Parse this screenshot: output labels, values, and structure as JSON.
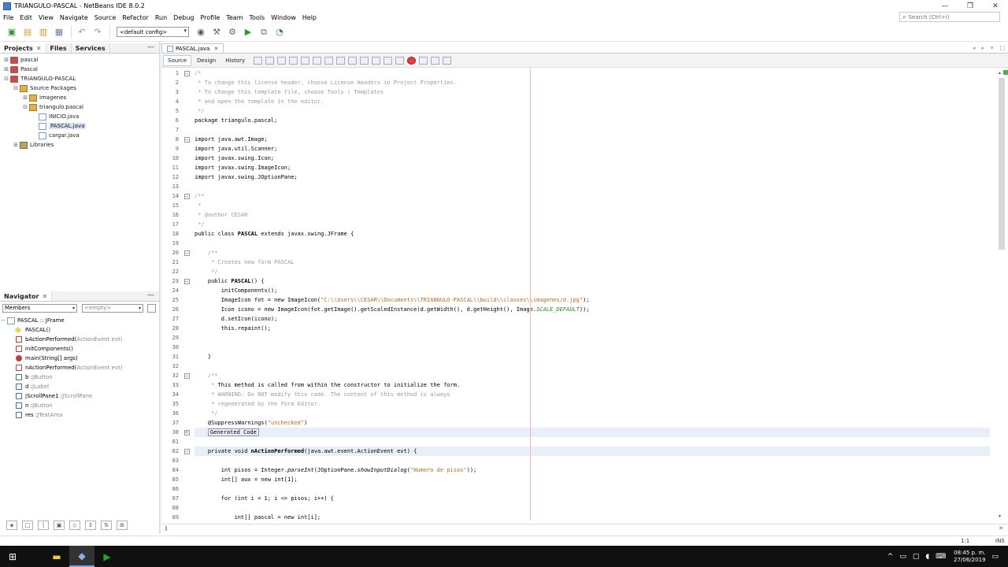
{
  "window": {
    "title": "TRIANGULO-PASCAL - NetBeans IDE 8.0.2",
    "controls": {
      "minimize": "—",
      "restore": "❐",
      "close": "✕"
    }
  },
  "menu": [
    "File",
    "Edit",
    "View",
    "Navigate",
    "Source",
    "Refactor",
    "Run",
    "Debug",
    "Profile",
    "Team",
    "Tools",
    "Window",
    "Help"
  ],
  "search": {
    "placeholder": "Search (Ctrl+I)"
  },
  "toolbar": {
    "config": "<default config>"
  },
  "projects_panel": {
    "tabs": [
      "Projects",
      "Files",
      "Services"
    ],
    "tree": [
      {
        "label": "pascal",
        "depth": 0,
        "icon": "proj",
        "twisty": "+"
      },
      {
        "label": "Pascal",
        "depth": 0,
        "icon": "proj",
        "twisty": "+"
      },
      {
        "label": "TRIANGULO-PASCAL",
        "depth": 0,
        "icon": "proj",
        "twisty": "−"
      },
      {
        "label": "Source Packages",
        "depth": 1,
        "icon": "pkg",
        "twisty": "−"
      },
      {
        "label": "imagenes",
        "depth": 2,
        "icon": "pkg",
        "twisty": "+"
      },
      {
        "label": "triangulo.pascal",
        "depth": 2,
        "icon": "pkg",
        "twisty": "−"
      },
      {
        "label": "INICIO.java",
        "depth": 3,
        "icon": "java",
        "twisty": ""
      },
      {
        "label": "PASCAL.java",
        "depth": 3,
        "icon": "java",
        "twisty": "",
        "selected": true
      },
      {
        "label": "cargar.java",
        "depth": 3,
        "icon": "java",
        "twisty": ""
      },
      {
        "label": "Libraries",
        "depth": 1,
        "icon": "lib",
        "twisty": "+"
      }
    ]
  },
  "navigator": {
    "title": "Navigator",
    "filter": "Members",
    "empty": "<empty>",
    "root": "PASCAL :: JFrame",
    "members": [
      {
        "name": "PASCAL()",
        "type": "",
        "icon": "ctor"
      },
      {
        "name": "bActionPerformed(",
        "type": "ActionEvent evt)",
        "icon": "priv"
      },
      {
        "name": "initComponents()",
        "type": "",
        "icon": "priv"
      },
      {
        "name": "main(String[] args)",
        "type": "",
        "icon": "pub"
      },
      {
        "name": "nActionPerformed(",
        "type": "ActionEvent evt)",
        "icon": "priv"
      },
      {
        "name": "b : ",
        "type": "JButton",
        "icon": "field"
      },
      {
        "name": "d : ",
        "type": "JLabel",
        "icon": "field"
      },
      {
        "name": "jScrollPane1 : ",
        "type": "JScrollPane",
        "icon": "field"
      },
      {
        "name": "n : ",
        "type": "JButton",
        "icon": "field"
      },
      {
        "name": "res : ",
        "type": "JTextArea",
        "icon": "field"
      }
    ]
  },
  "editor": {
    "tab": "PASCAL.java",
    "views": [
      "Source",
      "Design",
      "History"
    ],
    "lines": [
      {
        "n": "1",
        "fold": "−",
        "html": "<span class='cm'>/*</span>"
      },
      {
        "n": "2",
        "fold": "",
        "html": "<span class='cm'> * To change this license header, choose License Headers in Project Properties.</span>"
      },
      {
        "n": "3",
        "fold": "",
        "html": "<span class='cm'> * To change this template file, choose Tools | Templates</span>"
      },
      {
        "n": "4",
        "fold": "",
        "html": "<span class='cm'> * and open the template in the editor.</span>"
      },
      {
        "n": "5",
        "fold": "",
        "html": "<span class='cm'> */</span>"
      },
      {
        "n": "6",
        "fold": "",
        "html": "package triangulo.pascal;"
      },
      {
        "n": "7",
        "fold": "",
        "html": ""
      },
      {
        "n": "8",
        "fold": "−",
        "html": "import java.awt.Image;"
      },
      {
        "n": "9",
        "fold": "",
        "html": "import java.util.Scanner;"
      },
      {
        "n": "10",
        "fold": "",
        "html": "import javax.swing.Icon;"
      },
      {
        "n": "11",
        "fold": "",
        "html": "import javax.swing.ImageIcon;"
      },
      {
        "n": "12",
        "fold": "",
        "html": "import javax.swing.JOptionPane;"
      },
      {
        "n": "13",
        "fold": "",
        "html": ""
      },
      {
        "n": "14",
        "fold": "−",
        "html": "<span class='cm'>/**</span>"
      },
      {
        "n": "15",
        "fold": "",
        "html": "<span class='cm'> *</span>"
      },
      {
        "n": "16",
        "fold": "",
        "html": "<span class='cm'> * @author CESAR</span>"
      },
      {
        "n": "17",
        "fold": "",
        "html": "<span class='cm'> */</span>"
      },
      {
        "n": "18",
        "fold": "",
        "html": "public class <span class='bold'>PASCAL</span> extends javax.swing.JFrame {"
      },
      {
        "n": "19",
        "fold": "",
        "html": ""
      },
      {
        "n": "20",
        "fold": "−",
        "html": "    <span class='cm'>/**</span>"
      },
      {
        "n": "21",
        "fold": "",
        "html": "    <span class='cm'> * Creates new form PASCAL</span>"
      },
      {
        "n": "22",
        "fold": "",
        "html": "    <span class='cm'> */</span>"
      },
      {
        "n": "23",
        "fold": "−",
        "html": "    public <span class='bold'>PASCAL</span>() {"
      },
      {
        "n": "24",
        "fold": "",
        "html": "        initComponents();"
      },
      {
        "n": "25",
        "fold": "",
        "html": "        ImageIcon fot = new ImageIcon(<span class='str'>\"C:\\\\Users\\\\CESAR\\\\Documents\\\\TRIANGULO-PASCAL\\\\build\\\\classes\\\\imagenes/d.jpg\"</span>);"
      },
      {
        "n": "26",
        "fold": "",
        "html": "        Icon icono = new ImageIcon(fot.getImage().getScaledInstance(d.getWidth(), d.getHeight(), Image.<span class='grn'>SCALE_DEFAULT</span>));"
      },
      {
        "n": "27",
        "fold": "",
        "html": "        d.setIcon(icono);"
      },
      {
        "n": "28",
        "fold": "",
        "html": "        this.repaint();"
      },
      {
        "n": "29",
        "fold": "",
        "html": ""
      },
      {
        "n": "30",
        "fold": "",
        "html": ""
      },
      {
        "n": "31",
        "fold": "",
        "html": "    }"
      },
      {
        "n": "32",
        "fold": "",
        "html": ""
      },
      {
        "n": "32",
        "fold": "−",
        "html": "    <span class='cm'>/**</span>"
      },
      {
        "n": "33",
        "fold": "",
        "html": "    <span class='cm'> * </span>This method is called from within the constructor to initialize the form."
      },
      {
        "n": "34",
        "fold": "",
        "html": "    <span class='cm'> * WARNING: Do NOT modify this code. The content of this method is always</span>"
      },
      {
        "n": "35",
        "fold": "",
        "html": "    <span class='cm'> * regenerated by the Form Editor.</span>"
      },
      {
        "n": "36",
        "fold": "",
        "html": "    <span class='cm'> */</span>"
      },
      {
        "n": "37",
        "fold": "",
        "html": "    @SuppressWarnings(<span class='str'>\"unchecked\"</span>)"
      },
      {
        "n": "38",
        "fold": "+",
        "html": "    <span class='gen'>Generated Code</span>",
        "hl": true
      },
      {
        "n": "81",
        "fold": "",
        "html": ""
      },
      {
        "n": "82",
        "fold": "−",
        "html": "    private void <span class='bold'>nActionPerformed</span>(java.awt.event.ActionEvent evt) {",
        "hl": true
      },
      {
        "n": "83",
        "fold": "",
        "html": ""
      },
      {
        "n": "84",
        "fold": "",
        "html": "        int pisos = Integer.<span class='it'>parseInt</span>(JOptionPane.<span class='it'>showInputDialog</span>(<span class='str'>\"Numero de pisos\"</span>));"
      },
      {
        "n": "85",
        "fold": "",
        "html": "        int[] aux = new int[1];"
      },
      {
        "n": "86",
        "fold": "",
        "html": ""
      },
      {
        "n": "87",
        "fold": "",
        "html": "        for (int i = 1; i &lt;= pisos; i++) {"
      },
      {
        "n": "88",
        "fold": "",
        "html": ""
      },
      {
        "n": "89",
        "fold": "",
        "html": "            int[] pascal = new int[i];"
      },
      {
        "n": "90",
        "fold": "",
        "html": ""
      }
    ]
  },
  "status": {
    "position": "1:1",
    "mode": "INS"
  },
  "taskbar": {
    "time": "08:45 p. m.",
    "date": "27/06/2019"
  }
}
